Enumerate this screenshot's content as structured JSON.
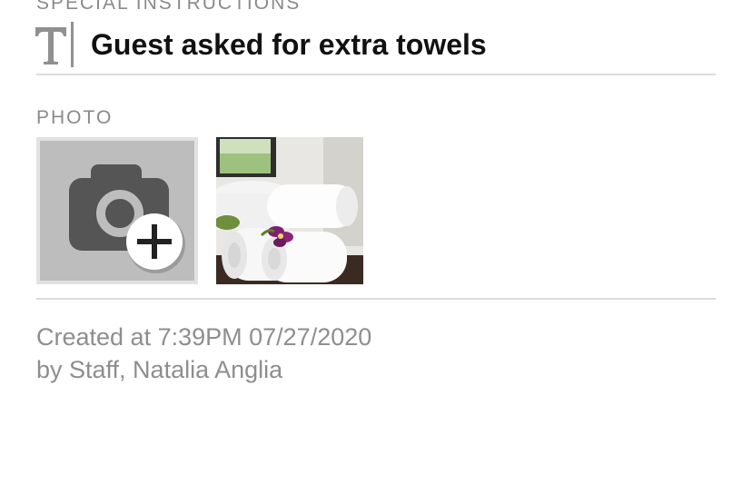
{
  "special_instructions": {
    "section_label": "SPECIAL INSTRUCTIONS",
    "icon": "text-format-icon",
    "text": "Guest asked for extra towels"
  },
  "photo": {
    "section_label": "PHOTO",
    "add_icon": "camera-add-icon",
    "thumbnails": [
      {
        "subject": "rolled white towels with purple orchid"
      }
    ]
  },
  "meta": {
    "created": "Created at 7:39PM 07/27/2020",
    "author": "by Staff, Natalia Anglia"
  },
  "colors": {
    "label": "#8a8a8a",
    "text": "#111111",
    "divider": "#dcdcdc",
    "meta": "#8e8e8e",
    "add_tile_bg": "#bdbdbd",
    "camera": "#555555"
  }
}
